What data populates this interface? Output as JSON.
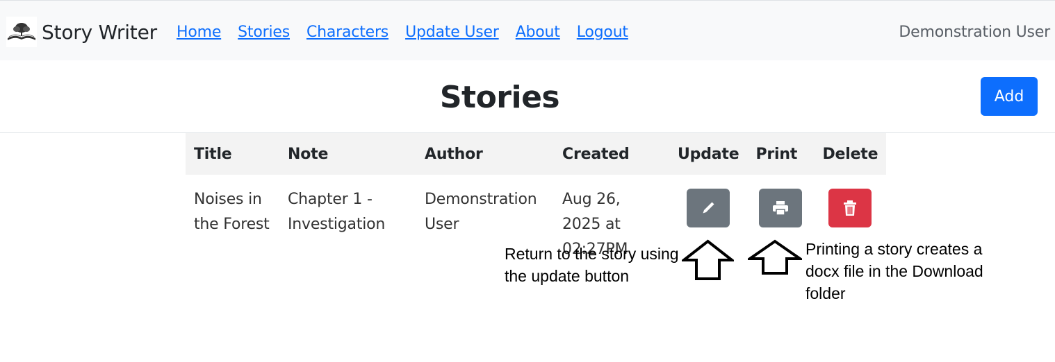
{
  "app": {
    "brand": "Story Writer",
    "current_user": "Demonstration User"
  },
  "nav": {
    "items": [
      {
        "label": "Home"
      },
      {
        "label": "Stories"
      },
      {
        "label": "Characters"
      },
      {
        "label": "Update User"
      },
      {
        "label": "About"
      },
      {
        "label": "Logout"
      }
    ]
  },
  "page": {
    "title": "Stories",
    "add_label": "Add"
  },
  "table": {
    "headers": [
      "Title",
      "Note",
      "Author",
      "Created",
      "Update",
      "Print",
      "Delete"
    ],
    "rows": [
      {
        "title": "Noises in the Forest",
        "note": "Chapter 1 - Investigation",
        "author": "Demonstration User",
        "created": "Aug 26, 2025 at 02:27PM"
      }
    ]
  },
  "annotations": {
    "update_hint": "Return to the story using the update button",
    "print_hint": "Printing a story creates a docx file in the Download folder"
  },
  "colors": {
    "primary": "#0d6efd",
    "secondary": "#6c757d",
    "danger": "#dc3545"
  },
  "icons": {
    "brand": "open-book-tree-icon",
    "update": "pencil-icon",
    "print": "printer-icon",
    "delete": "trash-icon",
    "arrow": "up-arrow-icon"
  }
}
